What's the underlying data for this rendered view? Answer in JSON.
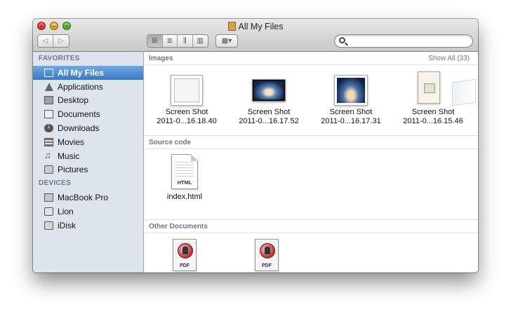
{
  "window": {
    "title": "All My Files"
  },
  "toolbar": {
    "nav": {
      "back_icon": "back-arrow-icon",
      "forward_icon": "forward-arrow-icon"
    },
    "views": [
      {
        "name": "icon-view",
        "glyph": "⊞",
        "active": true
      },
      {
        "name": "list-view",
        "glyph": "≣",
        "active": false
      },
      {
        "name": "column-view",
        "glyph": "⫼",
        "active": false
      },
      {
        "name": "cover-flow-view",
        "glyph": "▥",
        "active": false
      }
    ],
    "arrange_glyph": "▦▾",
    "search": {
      "placeholder": "",
      "value": ""
    }
  },
  "sidebar": {
    "favorites_header": "FAVORITES",
    "favorites": [
      {
        "label": "All My Files",
        "icon": "all-my-files-icon",
        "selected": true
      },
      {
        "label": "Applications",
        "icon": "applications-icon",
        "selected": false
      },
      {
        "label": "Desktop",
        "icon": "desktop-icon",
        "selected": false
      },
      {
        "label": "Documents",
        "icon": "documents-icon",
        "selected": false
      },
      {
        "label": "Downloads",
        "icon": "downloads-icon",
        "selected": false
      },
      {
        "label": "Movies",
        "icon": "movies-icon",
        "selected": false
      },
      {
        "label": "Music",
        "icon": "music-icon",
        "selected": false
      },
      {
        "label": "Pictures",
        "icon": "pictures-icon",
        "selected": false
      }
    ],
    "devices_header": "DEVICES",
    "devices": [
      {
        "label": "MacBook Pro",
        "icon": "macbook-icon"
      },
      {
        "label": "Lion",
        "icon": "disk-icon"
      },
      {
        "label": "iDisk",
        "icon": "idisk-icon"
      }
    ]
  },
  "content": {
    "images": {
      "header": "Images",
      "show_all": "Show All (33)",
      "items": [
        {
          "line1": "Screen Shot",
          "line2": "2011-0...16.18.40"
        },
        {
          "line1": "Screen Shot",
          "line2": "2011-0...16.17.52"
        },
        {
          "line1": "Screen Shot",
          "line2": "2011-0...16.17.31"
        },
        {
          "line1": "Screen Shot",
          "line2": "2011-0...16.15.46"
        }
      ]
    },
    "source_code": {
      "header": "Source code",
      "items": [
        {
          "name": "index.html",
          "type_label": "HTML"
        }
      ]
    },
    "other_documents": {
      "header": "Other Documents",
      "items": [
        {
          "type_label": "PDF"
        },
        {
          "type_label": "PDF"
        }
      ]
    }
  },
  "colors": {
    "selection": "#3b79c6",
    "sidebar_bg": "#dde4ec",
    "section_header": "#6d7785"
  }
}
